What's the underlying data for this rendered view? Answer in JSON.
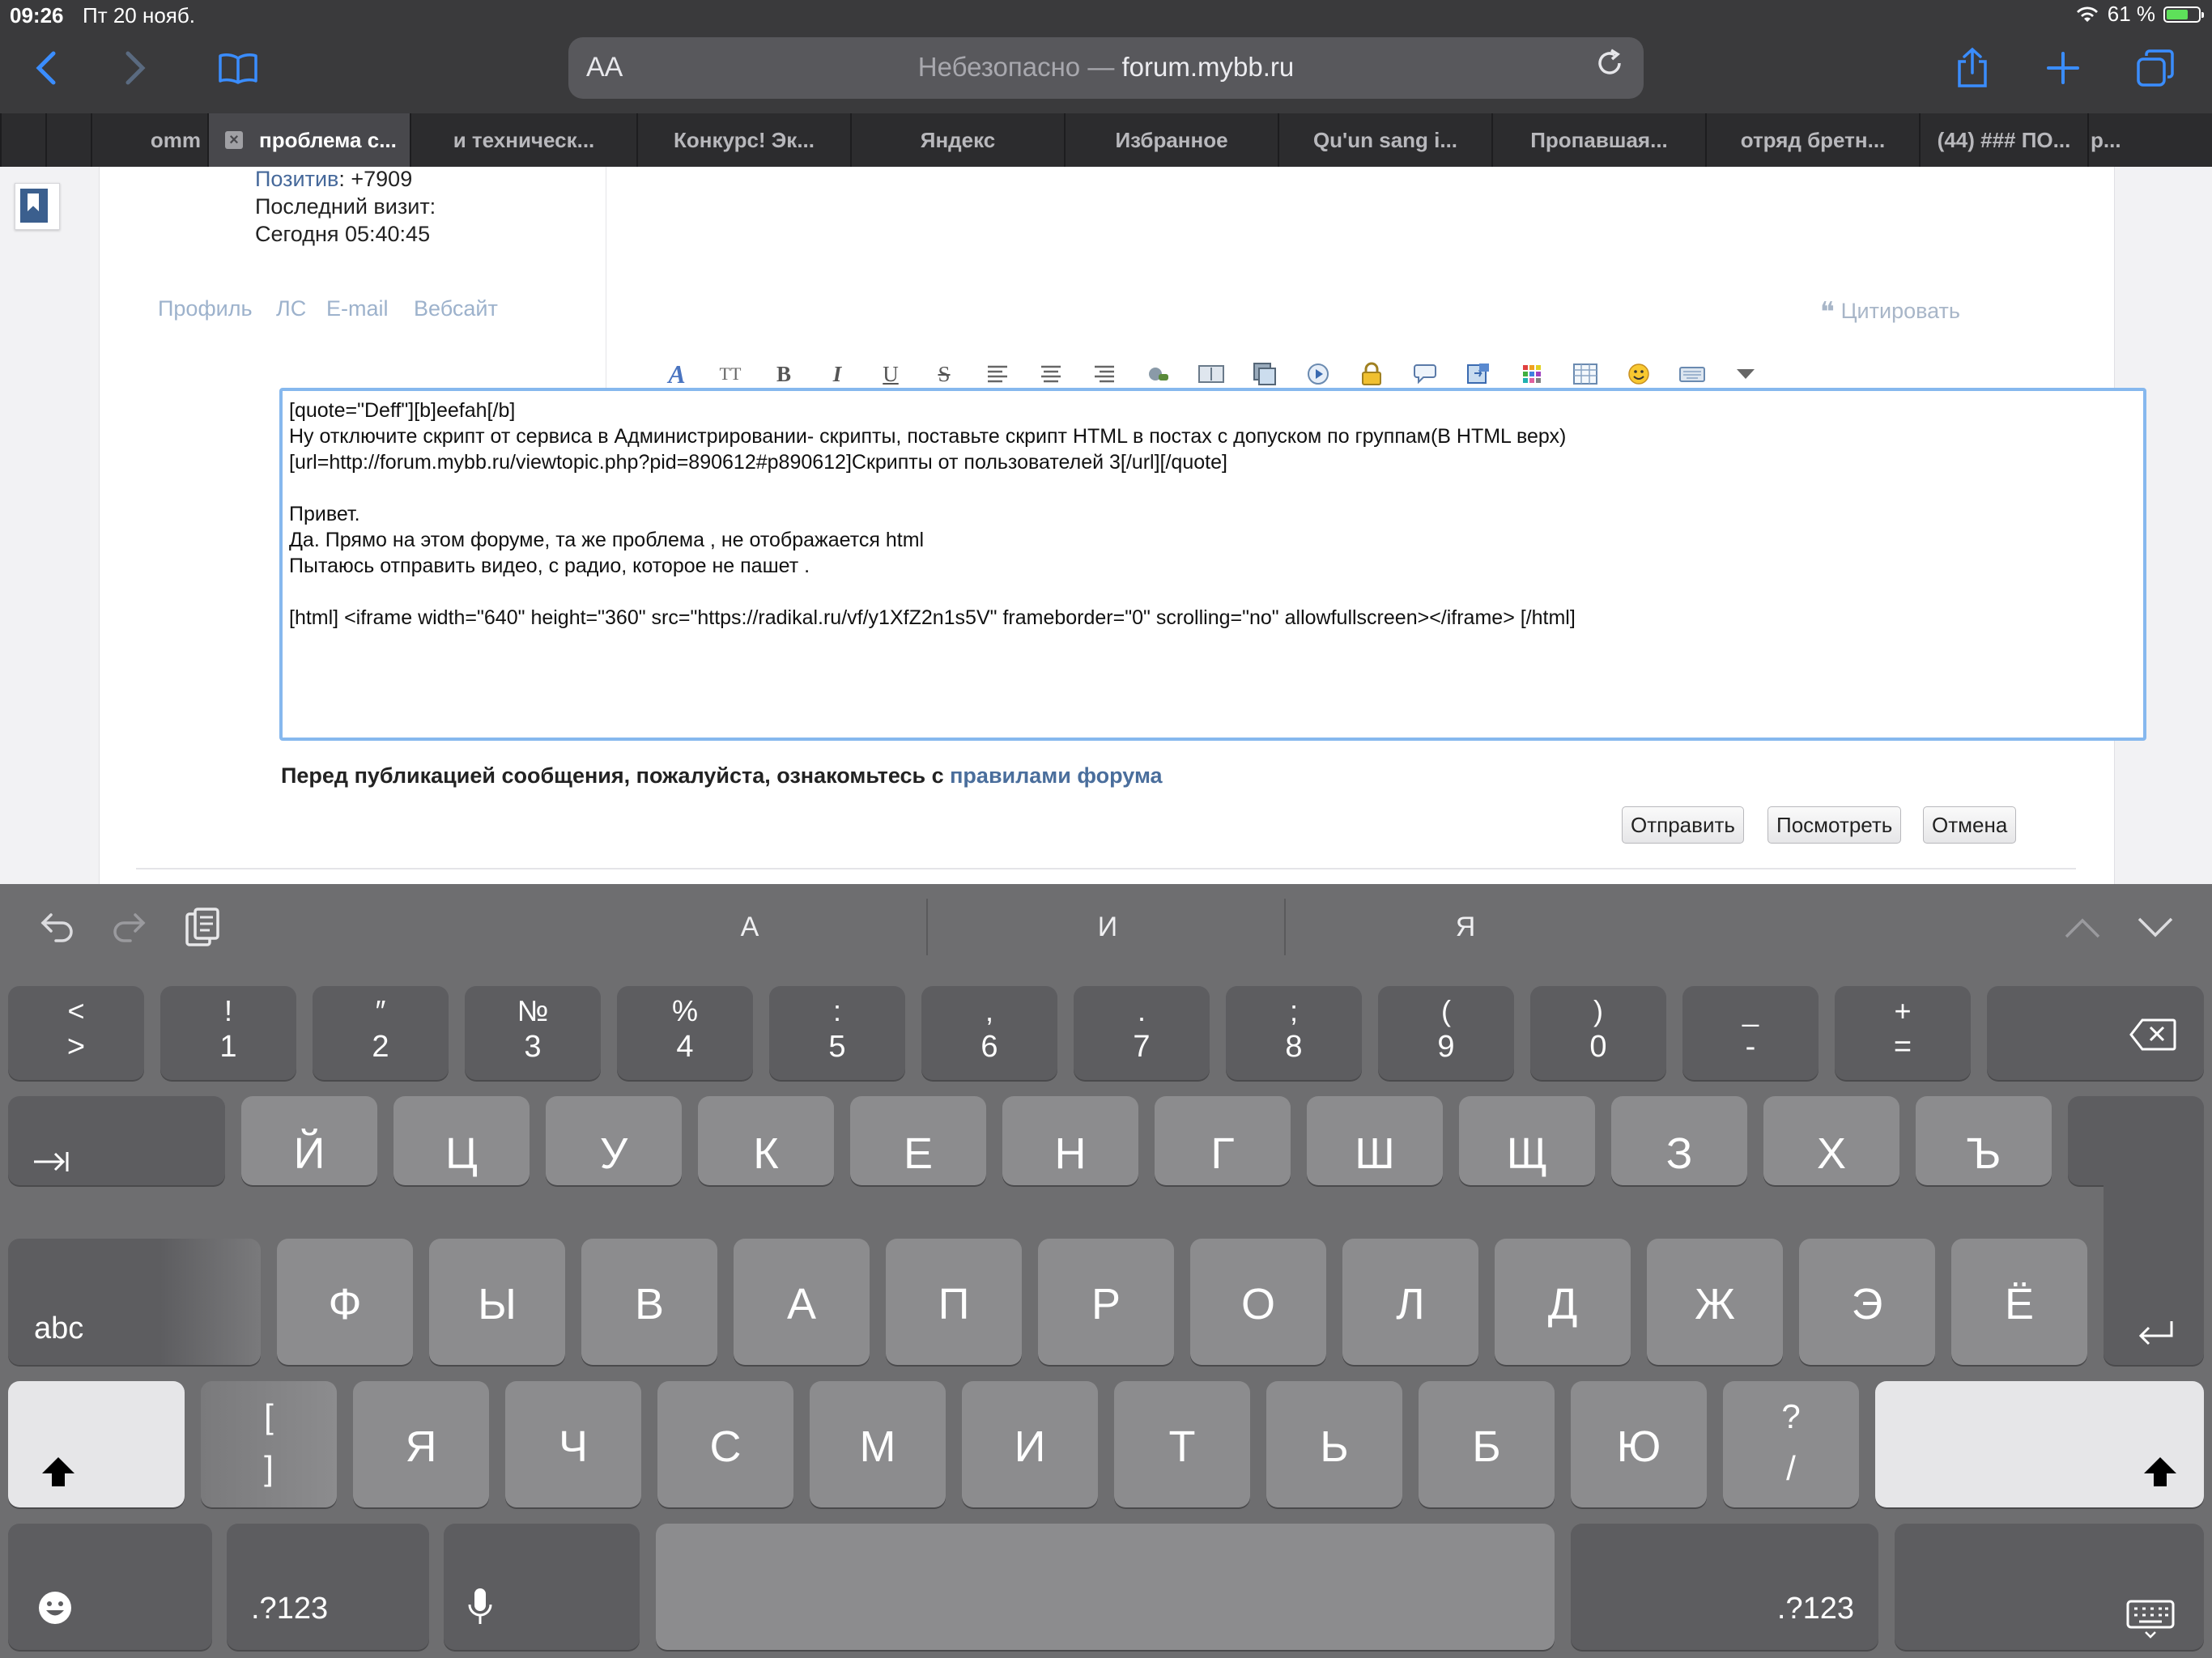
{
  "status": {
    "time": "09:26",
    "date": "Пт 20 нояб.",
    "battery": "61 %",
    "battery_level": 0.61
  },
  "browser": {
    "aa": "AA",
    "address_prefix": "Небезопасно — ",
    "address_domain": "forum.mybb.ru",
    "tabs": [
      "omm",
      "проблема с...",
      "и техническ...",
      "Конкурс! Эк...",
      "Яндекс",
      "Избранное",
      "Qu'un sang i...",
      "Пропавшая...",
      "отряд бретн...",
      "(44) ### ПО...",
      "р..."
    ]
  },
  "profile": {
    "positive_label": "Позитив",
    "positive_value": ": +7909",
    "last_visit_label": "Последний визит:",
    "last_visit_value": "Сегодня 05:40:45",
    "links": [
      "Профиль",
      "ЛС",
      "E-mail",
      "Вебсайт"
    ],
    "quote": "Цитировать"
  },
  "editor": {
    "lines": [
      "[quote=\"Deff\"][b]eefah[/b]",
      "Ну отключите скрипт от сервиса в Администрировании- скрипты, поставьте скрипт HTML в постах с допуском по группам(В HTML верх)",
      "[url=http://forum.mybb.ru/viewtopic.php?pid=890612#p890612]Скрипты от пользователей 3[/url][/quote]",
      "",
      "Привет.",
      "Да. Прямо на этом форуме, та же проблема , не отображается html",
      "Пытаюсь отправить видео, с радио, которое не пашет .",
      "",
      "[html] <iframe width=\"640\" height=\"360\" src=\"https://radikal.ru/vf/y1XfZ2n1s5V\" frameborder=\"0\" scrolling=\"no\" allowfullscreen></iframe> [/html]"
    ]
  },
  "form": {
    "rules_text": "Перед публикацией сообщения, пожалуйста, ознакомьтесь с ",
    "rules_link": "правилами форума",
    "submit": "Отправить",
    "preview": "Посмотреть",
    "cancel": "Отмена"
  },
  "keyboard": {
    "suggestions": [
      "А",
      "И",
      "Я"
    ],
    "row1": [
      {
        "t": "<",
        "b": ">"
      },
      {
        "t": "!",
        "b": "1"
      },
      {
        "t": "″",
        "b": "2"
      },
      {
        "t": "№",
        "b": "3"
      },
      {
        "t": "%",
        "b": "4"
      },
      {
        "t": ":",
        "b": "5"
      },
      {
        "t": ",",
        "b": "6"
      },
      {
        "t": ".",
        "b": "7"
      },
      {
        "t": ";",
        "b": "8"
      },
      {
        "t": "(",
        "b": "9"
      },
      {
        "t": ")",
        "b": "0"
      },
      {
        "t": "_",
        "b": "-"
      },
      {
        "t": "+",
        "b": "="
      }
    ],
    "row2": [
      "Й",
      "Ц",
      "У",
      "К",
      "Е",
      "Н",
      "Г",
      "Ш",
      "Щ",
      "З",
      "Х",
      "Ъ"
    ],
    "row3": [
      "Ф",
      "Ы",
      "В",
      "А",
      "П",
      "Р",
      "О",
      "Л",
      "Д",
      "Ж",
      "Э",
      "Ё"
    ],
    "row4": [
      "Я",
      "Ч",
      "С",
      "М",
      "И",
      "Т",
      "Ь",
      "Б",
      "Ю"
    ],
    "bracket": {
      "t": "[",
      "b": "]"
    },
    "slash": {
      "t": "?",
      "b": "/"
    },
    "abc": "abc",
    "num": ".?123",
    "accent": "#3a8dff"
  }
}
